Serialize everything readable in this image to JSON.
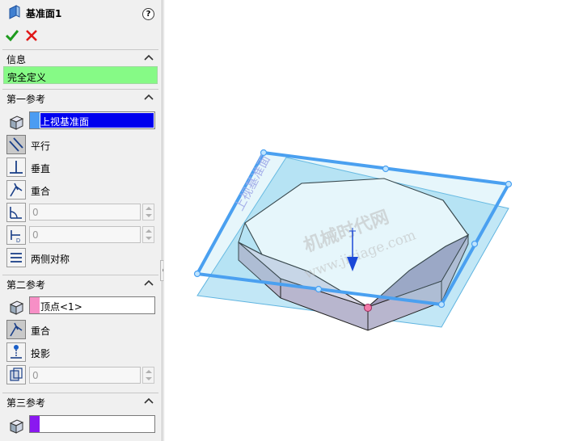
{
  "panel": {
    "title": "基准面1",
    "help": "?",
    "sections": {
      "info": {
        "label": "信息",
        "status": "完全定义"
      },
      "ref1": {
        "label": "第一参考",
        "selection": "上视基准面",
        "options": {
          "parallel": "平行",
          "perpendicular": "垂直",
          "coincident": "重合",
          "symmetric": "两侧对称"
        },
        "angle_value": "0",
        "distance_value": "0"
      },
      "ref2": {
        "label": "第二参考",
        "selection": "顶点<1>",
        "options": {
          "coincident": "重合",
          "project": "投影"
        },
        "count_value": "0"
      },
      "ref3": {
        "label": "第三参考",
        "selection": ""
      }
    },
    "colors": {
      "status_bg": "#86fa86",
      "ref1_swatch": "#4b9cf2",
      "ref1_highlight": "#0000ee",
      "ref2_swatch": "#f78fc6",
      "ref3_swatch": "#8a18f0"
    }
  },
  "viewport": {
    "plane_label": "上视基准面",
    "watermark_line1": "机械时代网",
    "watermark_line2": "www.jixiage.com",
    "colors": {
      "plane_fill": "#8fd4ef",
      "plane_frame": "#4aa0f0",
      "part_top": "#ffffff",
      "part_side": "#b8b6ce",
      "vertex_marker": "#f27aa8",
      "arrow": "#1a48d8"
    }
  }
}
